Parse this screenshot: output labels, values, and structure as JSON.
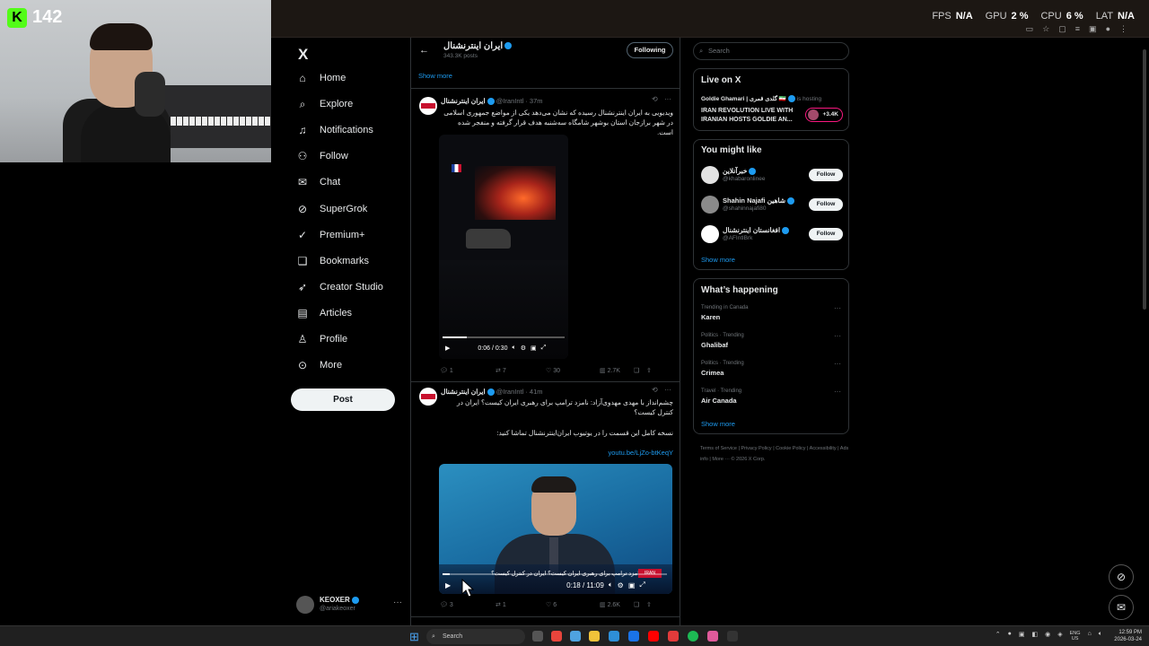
{
  "webcam": {
    "badge_count": "142"
  },
  "browser": {
    "perf": [
      {
        "label": "FPS",
        "value": "N/A"
      },
      {
        "label": "GPU",
        "value": "2 %"
      },
      {
        "label": "CPU",
        "value": "6 %"
      },
      {
        "label": "LAT",
        "value": "N/A"
      }
    ]
  },
  "sidebar": {
    "logo": "X",
    "items": [
      {
        "label": "Home",
        "icon": "home-icon",
        "glyph": "⌂"
      },
      {
        "label": "Explore",
        "icon": "search-icon",
        "glyph": "⌕"
      },
      {
        "label": "Notifications",
        "icon": "bell-icon",
        "glyph": "♫"
      },
      {
        "label": "Follow",
        "icon": "person-plus-icon",
        "glyph": "⚇"
      },
      {
        "label": "Chat",
        "icon": "envelope-icon",
        "glyph": "✉"
      },
      {
        "label": "SuperGrok",
        "icon": "grok-icon",
        "glyph": "⊘"
      },
      {
        "label": "Premium+",
        "icon": "premium-icon",
        "glyph": "✓"
      },
      {
        "label": "Bookmarks",
        "icon": "bookmark-icon",
        "glyph": "❑"
      },
      {
        "label": "Creator Studio",
        "icon": "rocket-icon",
        "glyph": "➶"
      },
      {
        "label": "Articles",
        "icon": "articles-icon",
        "glyph": "▤"
      },
      {
        "label": "Profile",
        "icon": "profile-icon",
        "glyph": "♙"
      },
      {
        "label": "More",
        "icon": "more-icon",
        "glyph": "⊙"
      }
    ],
    "post_label": "Post",
    "account": {
      "name": "KEOXER",
      "handle": "@ariakeoxer",
      "more": "···"
    }
  },
  "main": {
    "profile_name": "ایران اینترنشنال",
    "profile_posts": "343.3K posts",
    "following_label": "Following",
    "show_more": "Show more",
    "tweets": [
      {
        "name": "ایران اینترنشنال",
        "meta": "@IranIntl · 37m",
        "text": "ویدیویی به ایران اینترنشنال رسیده که نشان می‌دهد یکی از مواضع جمهوری اسلامی در شهر برازجان استان بوشهر شامگاه سه‌شنبه هدف قرار گرفته و منفجر شده است.",
        "video_time": "0:06 / 0:30",
        "progress": 0.2,
        "replies": "1",
        "reposts": "7",
        "likes": "30",
        "views": "2.7K"
      },
      {
        "name": "ایران اینترنشنال",
        "meta": "@IranIntl · 41m",
        "text": "چشم‌انداز با مهدی مهدوی‌آزاد: نامزد ترامپ برای رهبری ایران کیست؟ ایران در کنترل کیست؟",
        "text2": "نسخه کامل این قسمت را در یوتیوب ایران‌اینترنشنال تماشا کنید:",
        "link": "youtu.be/LjZo-btKeqY",
        "video_caption": "نامزد ترامپ برای رهبری ایران کیست؟ ایران در کنترل کیست؟",
        "video_logo": "IRAN",
        "video_time": "0:18 / 11:09",
        "progress": 0.03,
        "replies": "3",
        "reposts": "1",
        "likes": "6",
        "views": "2.6K"
      }
    ]
  },
  "right": {
    "search_placeholder": "Search",
    "live": {
      "title": "Live on X",
      "host": "Goldie Ghamari | گلدی قمری 🇮🇷",
      "status": "is hosting",
      "stream_title": "IRAN REVOLUTION LIVE WITH IRANIAN HOSTS GOLDIE AN...",
      "listeners": "+3.4K"
    },
    "might_like": {
      "title": "You might like",
      "users": [
        {
          "name": "خبرآنلاین",
          "handle": "@khabaronlinee",
          "follow": "Follow",
          "color": "#e2e2e2"
        },
        {
          "name": "Shahin Najafi شاهین",
          "handle": "@shahinnajafi80",
          "follow": "Follow",
          "color": "#8a8a8a"
        },
        {
          "name": "افغانستان اینترنشنال",
          "handle": "@AFIntlBrk",
          "follow": "Follow",
          "color": "#ffffff"
        }
      ],
      "show_more": "Show more"
    },
    "happening": {
      "title": "What’s happening",
      "trends": [
        {
          "category": "Trending in Canada",
          "name": "Karen"
        },
        {
          "category": "Politics · Trending",
          "name": "Ghalibaf"
        },
        {
          "category": "Politics · Trending",
          "name": "Crimea"
        },
        {
          "category": "Travel · Trending",
          "name": "Air Canada"
        }
      ],
      "show_more": "Show more"
    },
    "footer": "Terms of Service | Privacy Policy | Cookie Policy | Accessibility | Ads info | More ··· © 2026 X Corp."
  },
  "taskbar": {
    "search": "Search",
    "lang": "ENG",
    "region": "US",
    "time": "12:59 PM",
    "date": "2026-03-24"
  }
}
